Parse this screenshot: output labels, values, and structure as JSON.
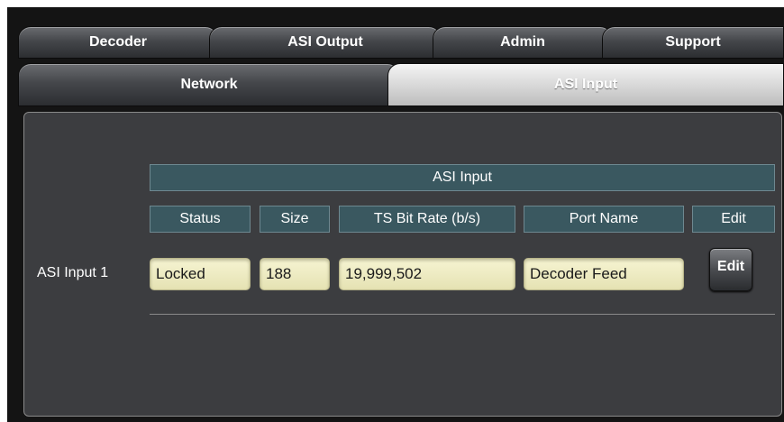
{
  "top_tabs": [
    {
      "label": "Decoder"
    },
    {
      "label": "ASI Output"
    },
    {
      "label": "Admin"
    },
    {
      "label": "Support"
    }
  ],
  "sub_tabs": [
    {
      "label": "Network",
      "active": false
    },
    {
      "label": "ASI Input",
      "active": true
    }
  ],
  "table": {
    "title": "ASI Input",
    "columns": [
      "Status",
      "Size",
      "TS Bit Rate (b/s)",
      "Port Name",
      "Edit"
    ],
    "rows": [
      {
        "label": "ASI Input 1",
        "status": "Locked",
        "size": "188",
        "bitrate": "19,999,502",
        "port_name": "Decoder Feed",
        "edit_label": "Edit"
      }
    ]
  },
  "colors": {
    "header_bg": "#3a5860",
    "field_bg": "#f2efc6",
    "panel_bg": "#3c3d40"
  }
}
